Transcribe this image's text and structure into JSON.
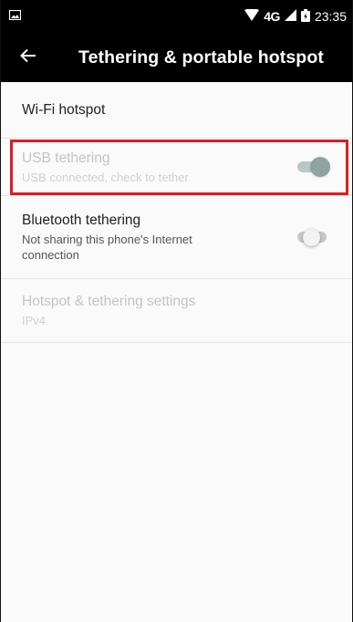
{
  "status_bar": {
    "network": "4G",
    "time": "23:35",
    "icons": [
      "image-notification-icon",
      "wifi-icon",
      "signal-icon",
      "battery-icon"
    ]
  },
  "app_bar": {
    "title": "Tethering & portable hotspot",
    "back_icon": "arrow-left-icon"
  },
  "items": [
    {
      "title": "Wi-Fi hotspot"
    },
    {
      "title": "USB tethering",
      "summary": "USB connected, check to tether",
      "enabled": false,
      "toggle": "on"
    },
    {
      "title": "Bluetooth tethering",
      "summary": "Not sharing this phone's Internet connection",
      "enabled": true,
      "toggle": "off"
    },
    {
      "title": "Hotspot & tethering settings",
      "summary": "IPv4",
      "enabled": false
    }
  ],
  "colors": {
    "highlight": "#e01b22",
    "bar_background": "#000000"
  }
}
